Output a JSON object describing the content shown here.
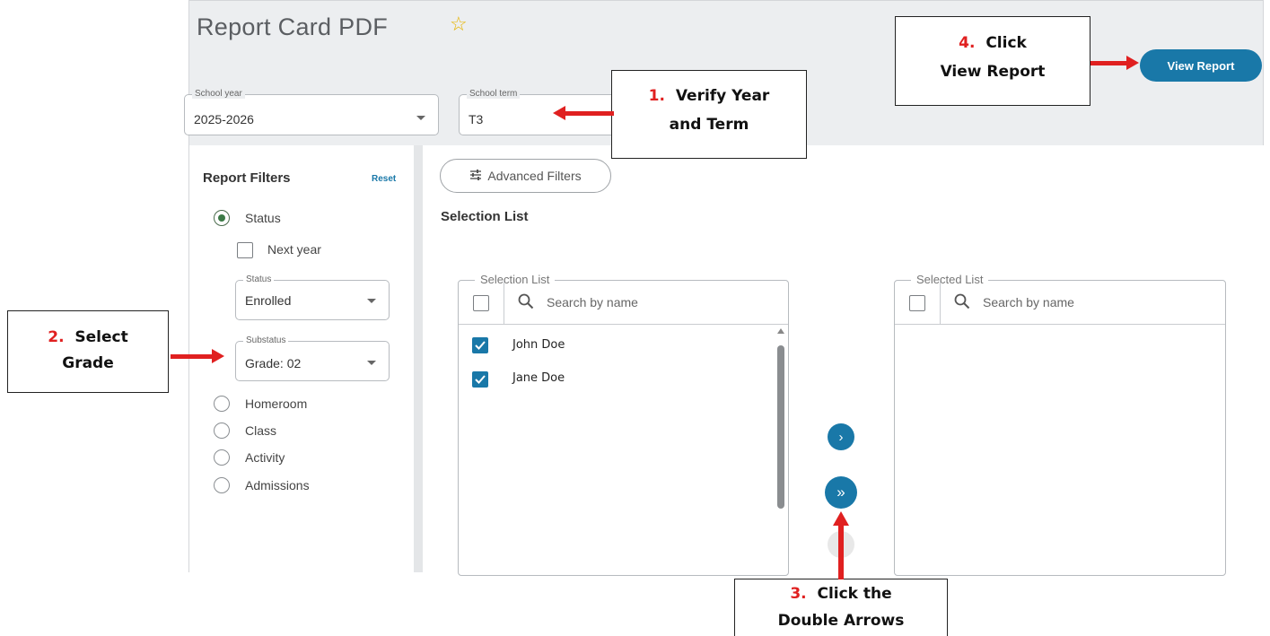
{
  "header": {
    "title": "Report Card PDF",
    "school_year": {
      "label": "School year",
      "value": "2025-2026"
    },
    "school_term": {
      "label": "School term",
      "value": "T3"
    },
    "view_report_label": "View Report"
  },
  "sidebar": {
    "title": "Report Filters",
    "reset_label": "Reset",
    "status_label": "Status",
    "next_year_label": "Next year",
    "status_field": {
      "label": "Status",
      "value": "Enrolled"
    },
    "substatus_field": {
      "label": "Substatus",
      "value": "Grade: 02"
    },
    "options": [
      "Homeroom",
      "Class",
      "Activity",
      "Admissions"
    ]
  },
  "main": {
    "advanced_filters_label": "Advanced Filters",
    "selection_title": "Selection List",
    "selection_box": {
      "legend": "Selection List",
      "search_placeholder": "Search by name",
      "items": [
        {
          "name": "John Doe",
          "checked": true
        },
        {
          "name": "Jane Doe",
          "checked": true
        }
      ]
    },
    "selected_box": {
      "legend": "Selected List",
      "search_placeholder": "Search by name"
    },
    "move_one_glyph": "›",
    "move_all_glyph": "»"
  },
  "callouts": {
    "c1": {
      "num": "1.",
      "line1": "Verify Year",
      "line2": "and Term"
    },
    "c2": {
      "num": "2.",
      "line1": "Select",
      "line2": "Grade"
    },
    "c3": {
      "num": "3.",
      "line1": "Click the",
      "line2": "Double Arrows"
    },
    "c4": {
      "num": "4.",
      "line1": "Click",
      "line2": "View Report"
    }
  },
  "colors": {
    "accent": "#1978a8",
    "annotation_red": "#e02020",
    "star": "#e6b400"
  }
}
